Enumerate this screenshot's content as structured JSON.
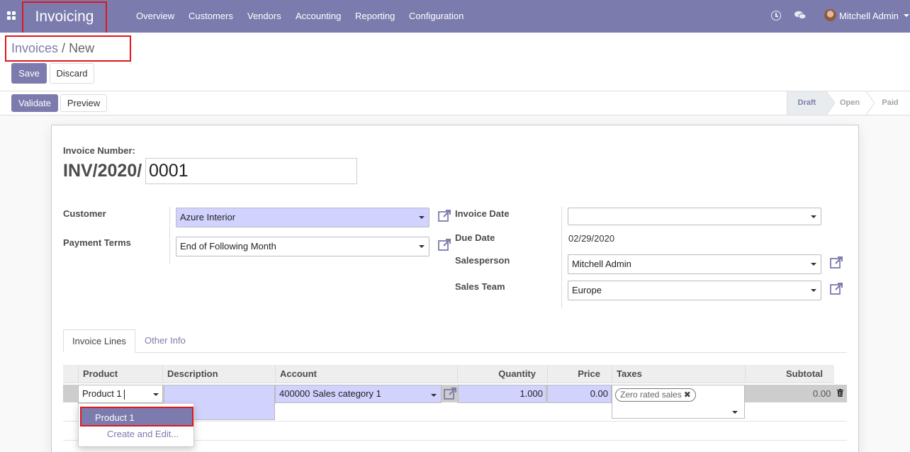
{
  "navbar": {
    "app_title": "Invoicing",
    "menu": [
      "Overview",
      "Customers",
      "Vendors",
      "Accounting",
      "Reporting",
      "Configuration"
    ],
    "user_name": "Mitchell Admin"
  },
  "breadcrumb": {
    "parent": "Invoices",
    "separator": "/",
    "current": "New"
  },
  "buttons": {
    "save": "Save",
    "discard": "Discard",
    "validate": "Validate",
    "preview": "Preview"
  },
  "stages": [
    "Draft",
    "Open",
    "Paid"
  ],
  "form": {
    "invoice_number_label": "Invoice Number:",
    "invoice_prefix": "INV/2020/",
    "invoice_number": "0001",
    "customer_label": "Customer",
    "customer_value": "Azure Interior",
    "payment_terms_label": "Payment Terms",
    "payment_terms_value": "End of Following Month",
    "invoice_date_label": "Invoice Date",
    "invoice_date_value": "",
    "due_date_label": "Due Date",
    "due_date_value": "02/29/2020",
    "salesperson_label": "Salesperson",
    "salesperson_value": "Mitchell Admin",
    "sales_team_label": "Sales Team",
    "sales_team_value": "Europe"
  },
  "tabs": {
    "invoice_lines": "Invoice Lines",
    "other_info": "Other Info"
  },
  "table": {
    "headers": {
      "product": "Product",
      "description": "Description",
      "account": "Account",
      "quantity": "Quantity",
      "price": "Price",
      "taxes": "Taxes",
      "subtotal": "Subtotal"
    },
    "row": {
      "product": "Product 1",
      "account": "400000 Sales category 1",
      "quantity": "1.000",
      "price": "0.00",
      "tax_tag": "Zero rated sales",
      "subtotal": "0.00"
    }
  },
  "autocomplete": {
    "option": "Product 1",
    "create_edit": "Create and Edit..."
  },
  "colors": {
    "brand": "#7c7bad",
    "required_field": "#d2d2ff",
    "highlight_border": "#e0161d"
  }
}
